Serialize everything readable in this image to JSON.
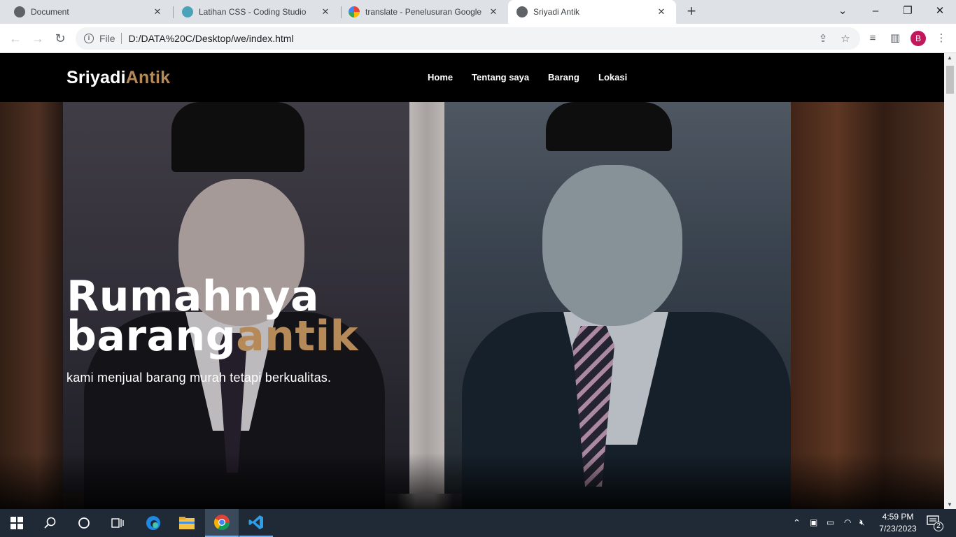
{
  "browser": {
    "tabs": [
      {
        "title": "Document",
        "active": false
      },
      {
        "title": "Latihan CSS - Coding Studio",
        "active": false
      },
      {
        "title": "translate - Penelusuran Google",
        "active": false
      },
      {
        "title": "Sriyadi Antik",
        "active": true
      }
    ],
    "address": {
      "scheme_label": "File",
      "url": "D:/DATA%20C/Desktop/we/index.html"
    },
    "profile_initial": "B"
  },
  "site": {
    "logo": {
      "main": "Sriyadi",
      "accent": "Antik"
    },
    "nav": [
      "Home",
      "Tentang saya",
      "Barang",
      "Lokasi"
    ],
    "hero": {
      "title_line1": "Rumahnya",
      "title_line2_main": "barang",
      "title_line2_accent": "antik",
      "subtitle": "kami menjual barang murah tetapi berkualitas."
    },
    "colors": {
      "accent": "#b68a58",
      "nav_bg": "#000000"
    }
  },
  "taskbar": {
    "time": "4:59 PM",
    "date": "7/23/2023",
    "notification_count": "2"
  }
}
